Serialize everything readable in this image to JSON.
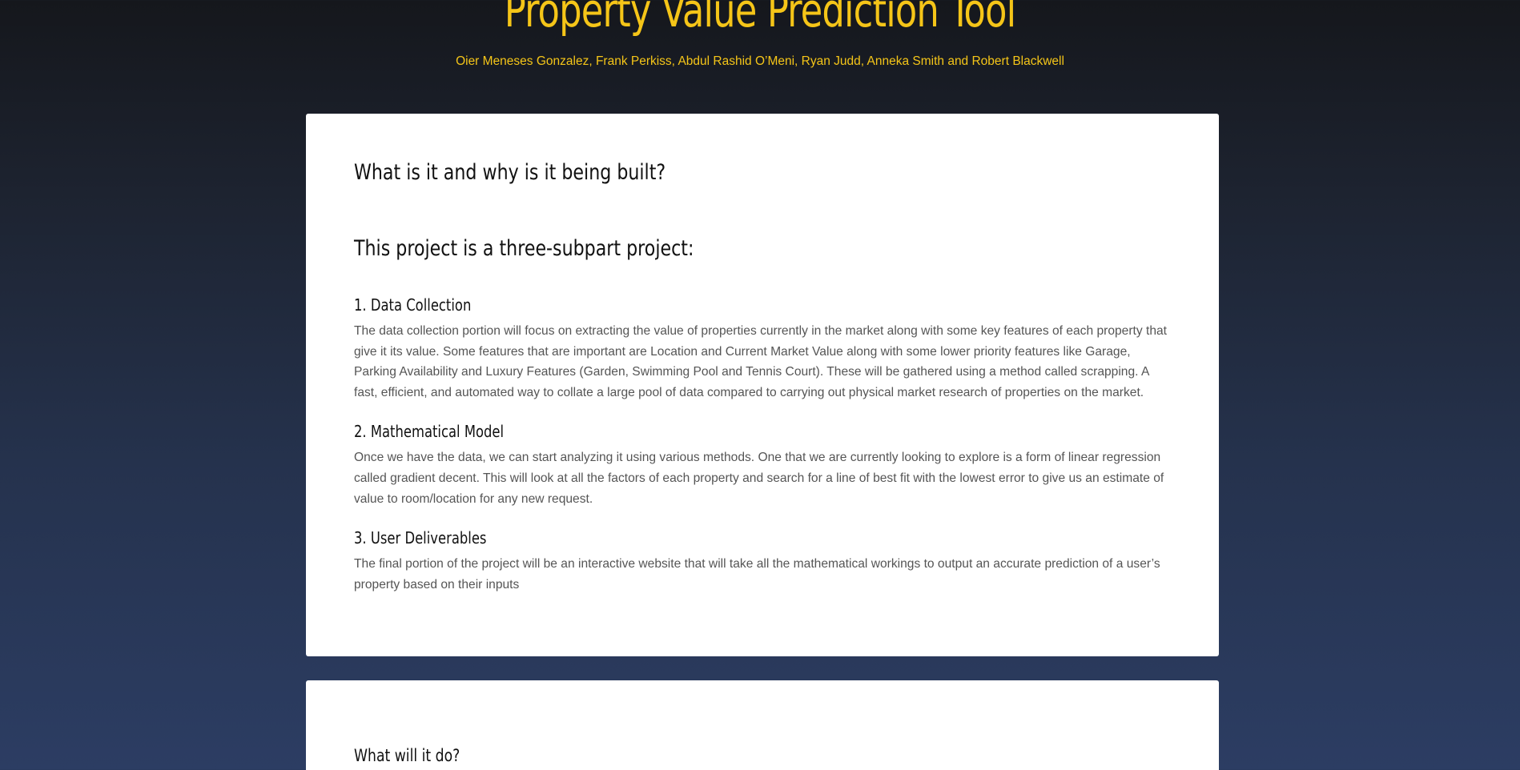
{
  "header": {
    "title": "Property Value Prediction Tool",
    "authors": "Oier Meneses Gonzalez, Frank Perkiss, Abdul Rashid O’Meni, Ryan Judd, Anneka Smith and Robert Blackwell"
  },
  "about": {
    "heading": "What is it and why is it being built?",
    "subheading": "This project is a three-subpart project:",
    "sections": [
      {
        "title": "1. Data Collection",
        "body": "The data collection portion will focus on extracting the value of properties currently in the market along with some key features of each property that give it its value. Some features that are important are Location and Current Market Value along with some lower priority features like Garage, Parking Availability and Luxury Features (Garden, Swimming Pool and Tennis Court). These will be gathered using a method called scrapping. A fast, efficient, and automated way to collate a large pool of data compared to carrying out physical market research of properties on the market."
      },
      {
        "title": "2. Mathematical Model",
        "body": "Once we have the data, we can start analyzing it using various methods. One that we are currently looking to explore is a form of linear regression called gradient decent. This will look at all the factors of each property and search for a line of best fit with the lowest error to give us an estimate of value to room/location for any new request."
      },
      {
        "title": "3. User Deliverables",
        "body": "The final portion of the project will be an interactive website that will take all the mathematical workings to output an accurate prediction of a user’s property based on their inputs"
      }
    ]
  },
  "next_card": {
    "heading": "What will it do?"
  },
  "colors": {
    "accent": "#f5c518",
    "card_bg": "#ffffff",
    "heading_text": "#111111",
    "body_text": "#555555"
  }
}
